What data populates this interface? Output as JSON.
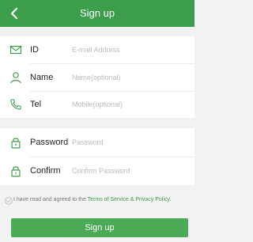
{
  "header": {
    "title": "Sign up",
    "back_icon": "chevron-left-icon"
  },
  "form": {
    "id": {
      "label": "ID",
      "placeholder": "E-mail Address",
      "icon": "envelope-icon"
    },
    "name": {
      "label": "Name",
      "placeholder": "Name(optional)",
      "icon": "person-icon"
    },
    "tel": {
      "label": "Tel",
      "placeholder": "Mobile(optional)",
      "icon": "phone-icon"
    },
    "password": {
      "label": "Password",
      "placeholder": "Password",
      "icon": "lock-icon"
    },
    "confirm": {
      "label": "Confirm",
      "placeholder": "Confirm Password",
      "icon": "lock-icon"
    }
  },
  "agreement": {
    "prefix": "I have read and agreed to the ",
    "link": "Terms of Service & Privacy Policy.",
    "icon": "check-circle-icon"
  },
  "submit": {
    "label": "Sign up"
  },
  "colors": {
    "accent": "#3c9d4b",
    "button": "#4caa57",
    "background": "#f2f2f2"
  }
}
